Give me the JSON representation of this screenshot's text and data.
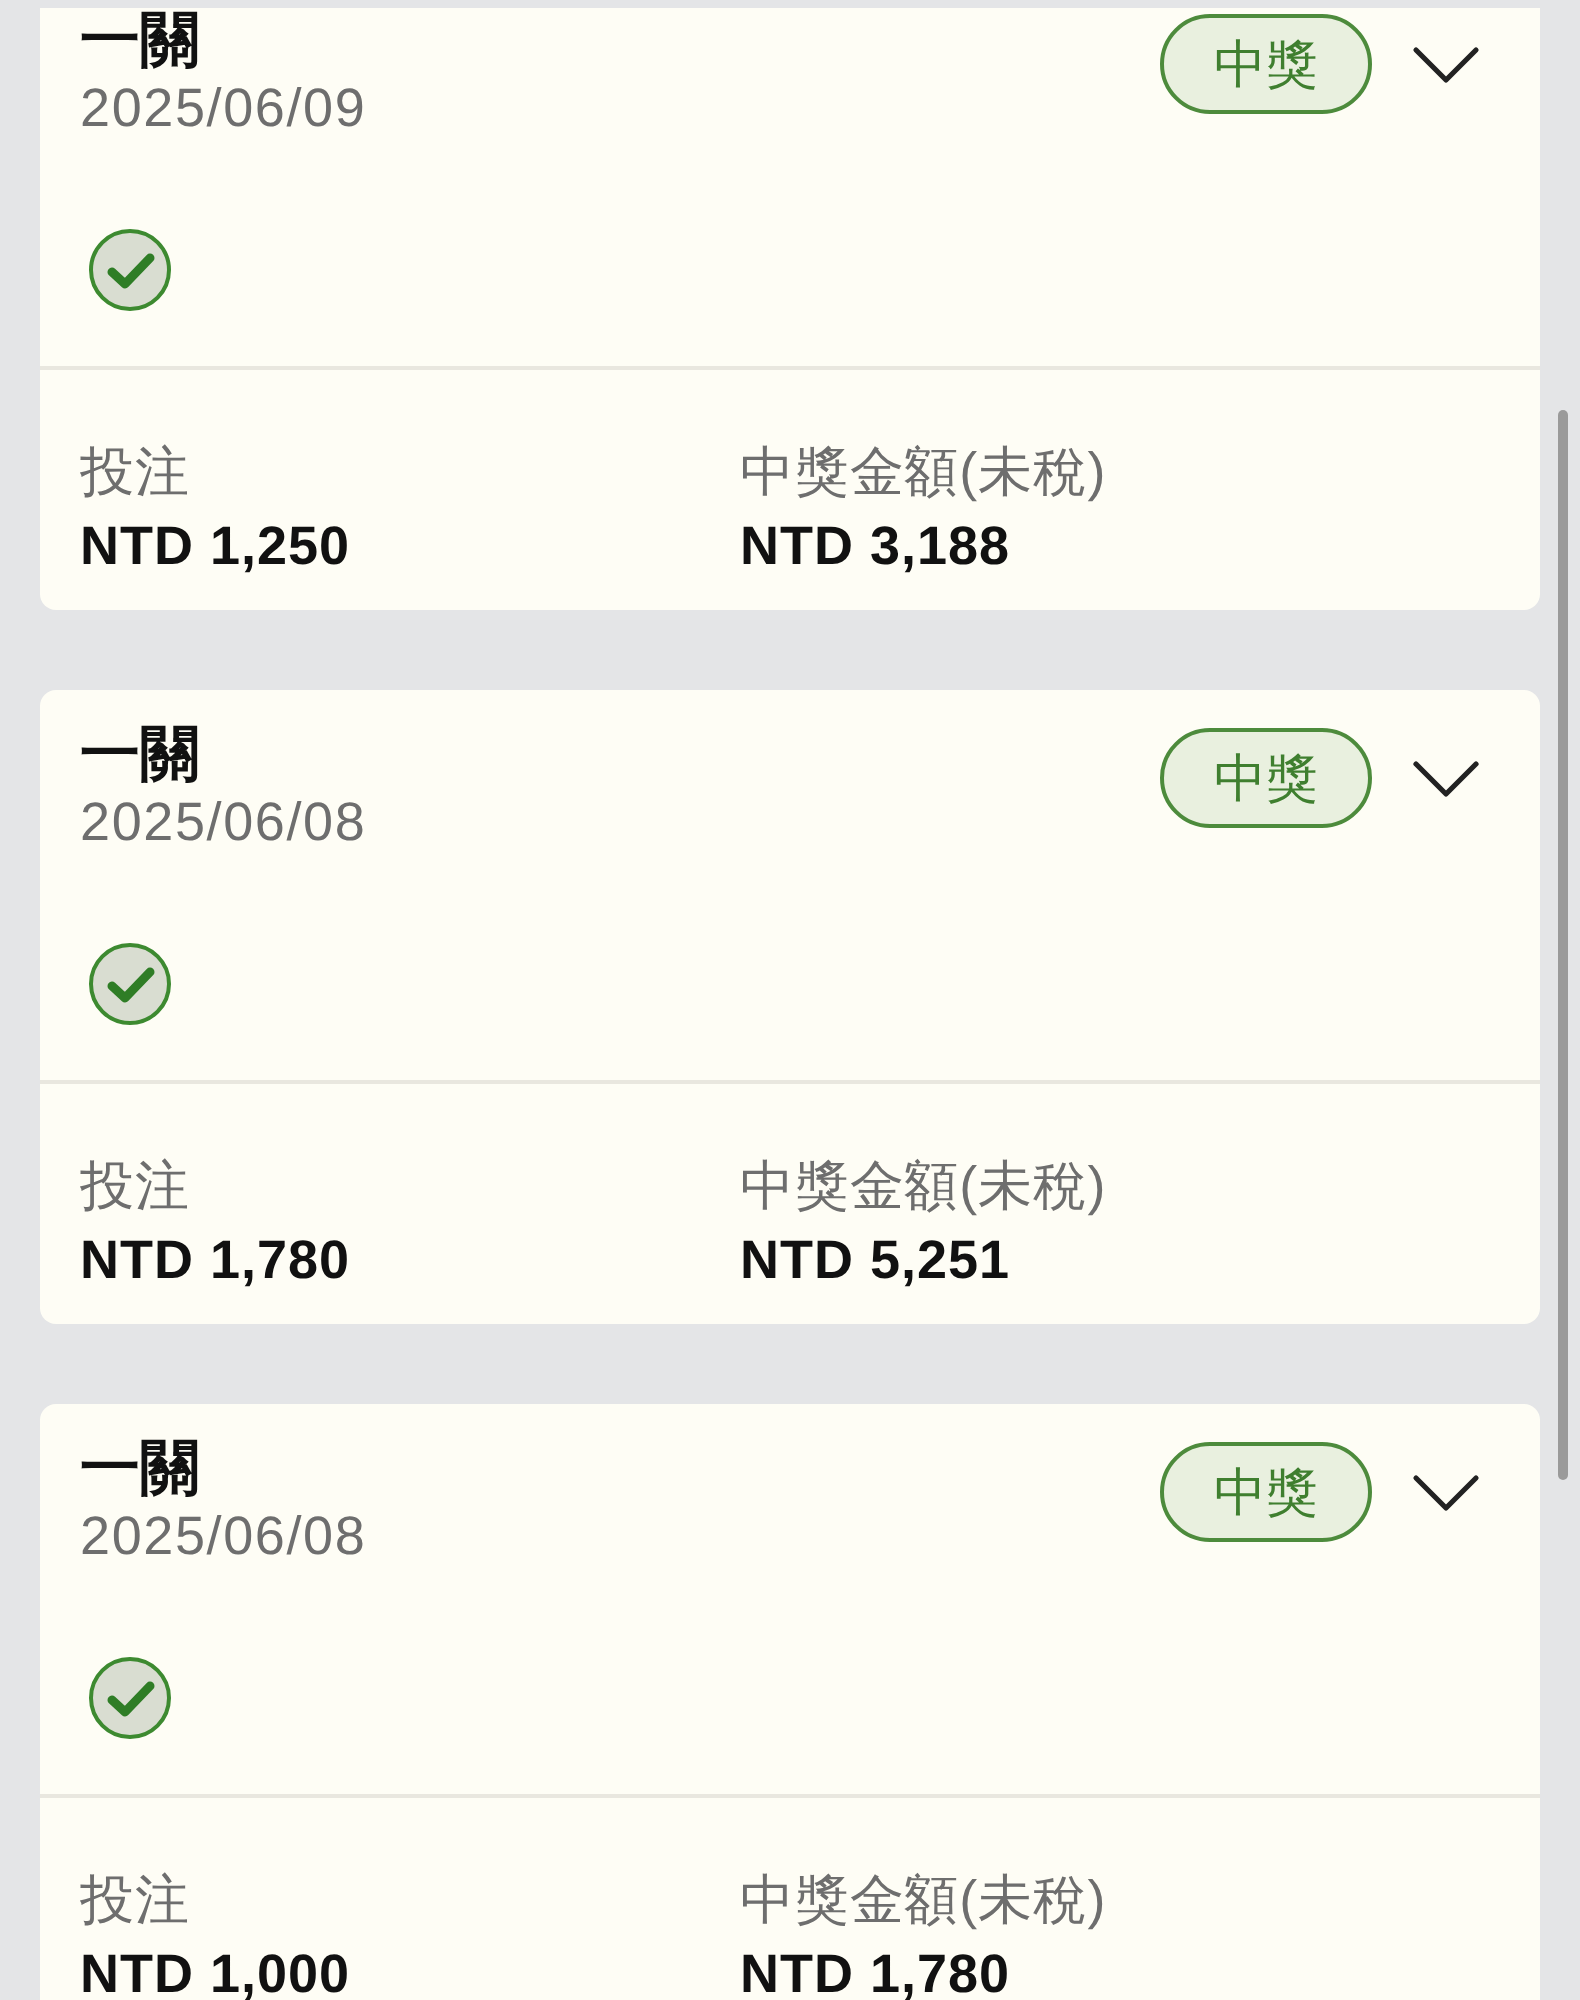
{
  "cards": [
    {
      "title": "一關",
      "date": "2025/06/09",
      "badge": "中獎",
      "expanded": false,
      "settled": true,
      "stake_label": "投注",
      "stake": "NTD 1,250",
      "payout_label": "中獎金額(未稅)",
      "payout": "NTD 3,188"
    },
    {
      "title": "一關",
      "date": "2025/06/08",
      "badge": "中獎",
      "expanded": false,
      "settled": true,
      "stake_label": "投注",
      "stake": "NTD 1,780",
      "payout_label": "中獎金額(未稅)",
      "payout": "NTD 5,251"
    },
    {
      "title": "一關",
      "date": "2025/06/08",
      "badge": "中獎",
      "expanded": false,
      "settled": true,
      "stake_label": "投注",
      "stake": "NTD 1,000",
      "payout_label": "中獎金額(未稅)",
      "payout": "NTD 1,780"
    }
  ]
}
